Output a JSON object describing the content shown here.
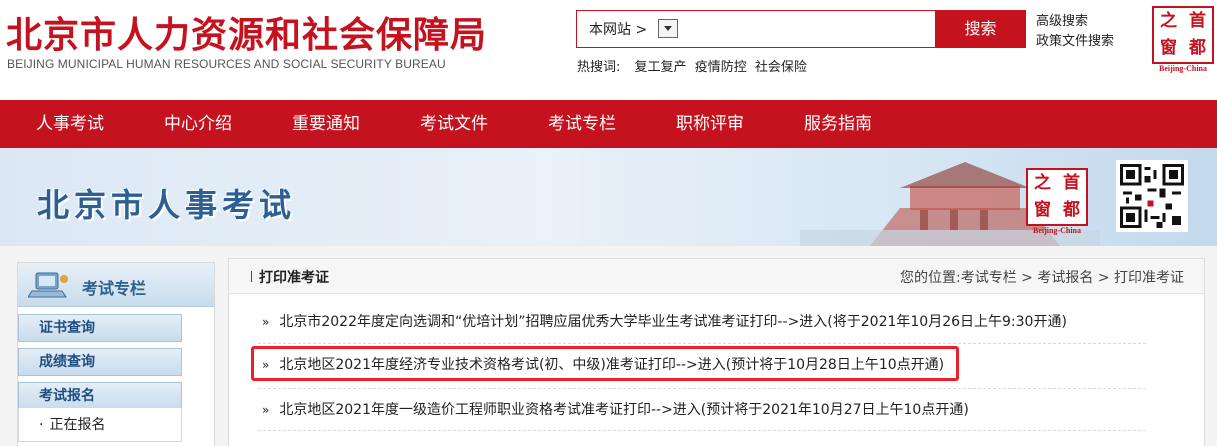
{
  "header": {
    "logo_cn": "北京市人力资源和社会保障局",
    "logo_en": "BEIJING MUNICIPAL HUMAN RESOURCES AND SOCIAL SECURITY BUREAU",
    "search_scope": "本网站 >",
    "search_placeholder": "",
    "search_button": "搜索",
    "advanced_search": "高级搜索",
    "policy_search": "政策文件搜索",
    "hot_label": "热搜词:",
    "hot_keywords": [
      "复工复产",
      "疫情防控",
      "社会保险"
    ],
    "seal": {
      "chars": [
        "之",
        "首",
        "窗",
        "都"
      ],
      "subtitle": "Beijing-China"
    }
  },
  "nav": {
    "items": [
      "人事考试",
      "中心介绍",
      "重要通知",
      "考试文件",
      "考试专栏",
      "职称评审",
      "服务指南"
    ]
  },
  "banner": {
    "title": "北京市人事考试",
    "seal": {
      "chars": [
        "之",
        "首",
        "窗",
        "都"
      ],
      "subtitle": "Beijing-China"
    }
  },
  "sidebar": {
    "title": "考试专栏",
    "buttons": [
      "证书查询",
      "成绩查询",
      "考试报名"
    ],
    "sub_item": "正在报名"
  },
  "content": {
    "title": "打印准考证",
    "breadcrumb": "您的位置:考试专栏 > 考试报名 > 打印准考证",
    "items": [
      "北京市2022年度定向选调和“优培计划”招聘应届优秀大学毕业生考试准考证打印-->进入(将于2021年10月26日上午9:30开通)",
      "北京地区2021年度经济专业技术资格考试(初、中级)准考证打印-->进入(预计将于10月28日上午10点开通)",
      "北京地区2021年度一级造价工程师职业资格考试准考证打印-->进入(预计将于2021年10月27日上午10点开通)"
    ],
    "bullet": "»"
  },
  "colors": {
    "brand_red": "#c5121f",
    "banner_blue": "#2d5f92",
    "highlight": "#e8212b"
  }
}
